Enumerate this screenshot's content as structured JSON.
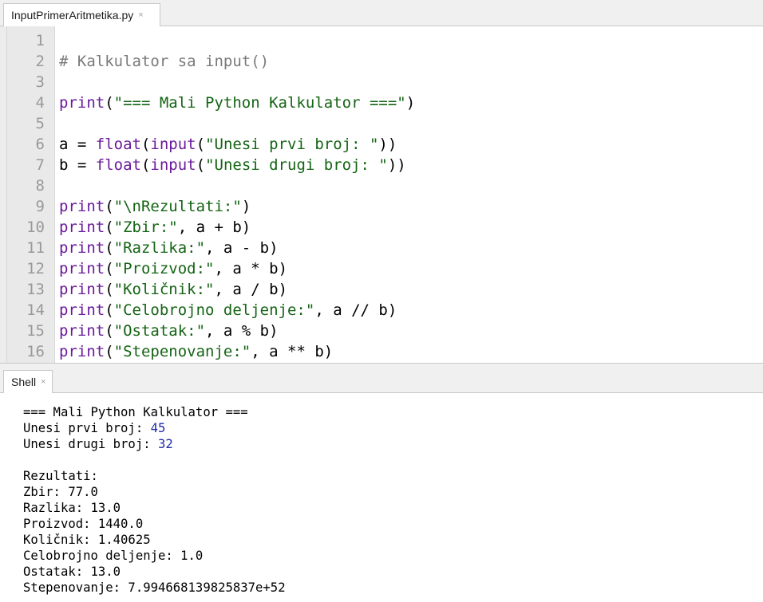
{
  "editor": {
    "tab_title": "InputPrimerAritmetika.py",
    "tab_close": "×",
    "lines": [
      {
        "num": "1",
        "tokens": []
      },
      {
        "num": "2",
        "tokens": [
          {
            "t": "# Kalkulator sa input()",
            "c": "comment"
          }
        ]
      },
      {
        "num": "3",
        "tokens": []
      },
      {
        "num": "4",
        "tokens": [
          {
            "t": "print",
            "c": "builtin"
          },
          {
            "t": "(",
            "c": "plain"
          },
          {
            "t": "\"=== Mali Python Kalkulator ===\"",
            "c": "string"
          },
          {
            "t": ")",
            "c": "plain"
          }
        ]
      },
      {
        "num": "5",
        "tokens": []
      },
      {
        "num": "6",
        "tokens": [
          {
            "t": "a = ",
            "c": "plain"
          },
          {
            "t": "float",
            "c": "builtin"
          },
          {
            "t": "(",
            "c": "plain"
          },
          {
            "t": "input",
            "c": "builtin"
          },
          {
            "t": "(",
            "c": "plain"
          },
          {
            "t": "\"Unesi prvi broj: \"",
            "c": "string"
          },
          {
            "t": "))",
            "c": "plain"
          }
        ]
      },
      {
        "num": "7",
        "tokens": [
          {
            "t": "b = ",
            "c": "plain"
          },
          {
            "t": "float",
            "c": "builtin"
          },
          {
            "t": "(",
            "c": "plain"
          },
          {
            "t": "input",
            "c": "builtin"
          },
          {
            "t": "(",
            "c": "plain"
          },
          {
            "t": "\"Unesi drugi broj: \"",
            "c": "string"
          },
          {
            "t": "))",
            "c": "plain"
          }
        ]
      },
      {
        "num": "8",
        "tokens": []
      },
      {
        "num": "9",
        "tokens": [
          {
            "t": "print",
            "c": "builtin"
          },
          {
            "t": "(",
            "c": "plain"
          },
          {
            "t": "\"\\nRezultati:\"",
            "c": "string"
          },
          {
            "t": ")",
            "c": "plain"
          }
        ]
      },
      {
        "num": "10",
        "tokens": [
          {
            "t": "print",
            "c": "builtin"
          },
          {
            "t": "(",
            "c": "plain"
          },
          {
            "t": "\"Zbir:\"",
            "c": "string"
          },
          {
            "t": ", a + b)",
            "c": "plain"
          }
        ]
      },
      {
        "num": "11",
        "tokens": [
          {
            "t": "print",
            "c": "builtin"
          },
          {
            "t": "(",
            "c": "plain"
          },
          {
            "t": "\"Razlika:\"",
            "c": "string"
          },
          {
            "t": ", a - b)",
            "c": "plain"
          }
        ]
      },
      {
        "num": "12",
        "tokens": [
          {
            "t": "print",
            "c": "builtin"
          },
          {
            "t": "(",
            "c": "plain"
          },
          {
            "t": "\"Proizvod:\"",
            "c": "string"
          },
          {
            "t": ", a * b)",
            "c": "plain"
          }
        ]
      },
      {
        "num": "13",
        "tokens": [
          {
            "t": "print",
            "c": "builtin"
          },
          {
            "t": "(",
            "c": "plain"
          },
          {
            "t": "\"Količnik:\"",
            "c": "string"
          },
          {
            "t": ", a / b)",
            "c": "plain"
          }
        ]
      },
      {
        "num": "14",
        "tokens": [
          {
            "t": "print",
            "c": "builtin"
          },
          {
            "t": "(",
            "c": "plain"
          },
          {
            "t": "\"Celobrojno deljenje:\"",
            "c": "string"
          },
          {
            "t": ", a // b)",
            "c": "plain"
          }
        ]
      },
      {
        "num": "15",
        "tokens": [
          {
            "t": "print",
            "c": "builtin"
          },
          {
            "t": "(",
            "c": "plain"
          },
          {
            "t": "\"Ostatak:\"",
            "c": "string"
          },
          {
            "t": ", a % b)",
            "c": "plain"
          }
        ]
      },
      {
        "num": "16",
        "tokens": [
          {
            "t": "print",
            "c": "builtin"
          },
          {
            "t": "(",
            "c": "plain"
          },
          {
            "t": "\"Stepenovanje:\"",
            "c": "string"
          },
          {
            "t": ", a ** b)",
            "c": "plain"
          }
        ]
      }
    ]
  },
  "shell": {
    "tab_title": "Shell",
    "tab_close": "×",
    "lines": [
      {
        "text": "=== Mali Python Kalkulator ===",
        "input": ""
      },
      {
        "text": "Unesi prvi broj: ",
        "input": "45"
      },
      {
        "text": "Unesi drugi broj: ",
        "input": "32"
      },
      {
        "text": "",
        "input": ""
      },
      {
        "text": "Rezultati:",
        "input": ""
      },
      {
        "text": "Zbir: 77.0",
        "input": ""
      },
      {
        "text": "Razlika: 13.0",
        "input": ""
      },
      {
        "text": "Proizvod: 1440.0",
        "input": ""
      },
      {
        "text": "Količnik: 1.40625",
        "input": ""
      },
      {
        "text": "Celobrojno deljenje: 1.0",
        "input": ""
      },
      {
        "text": "Ostatak: 13.0",
        "input": ""
      },
      {
        "text": "Stepenovanje: 7.994668139825837e+52",
        "input": ""
      }
    ]
  }
}
